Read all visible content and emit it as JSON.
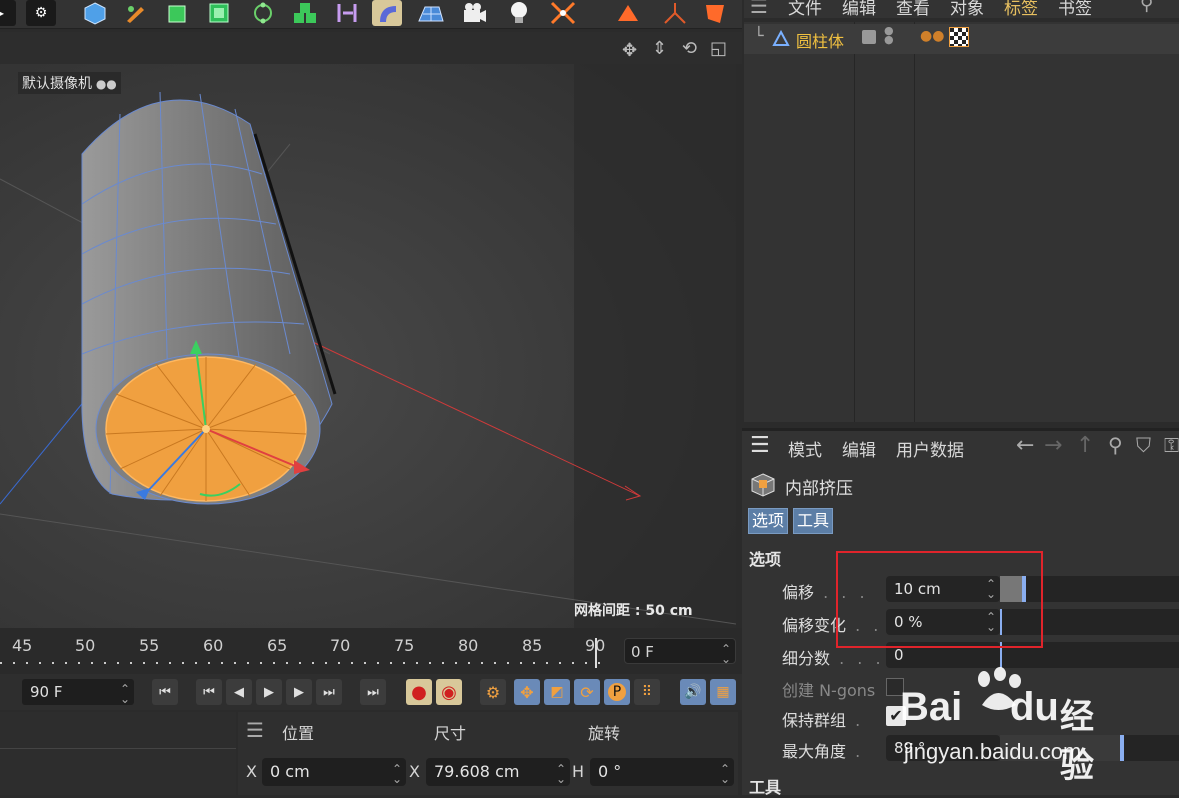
{
  "viewport": {
    "camera_label": "默认摄像机",
    "grid_spacing": "网格间距 : 50 cm"
  },
  "timeline": {
    "ticks": [
      "45",
      "50",
      "55",
      "60",
      "65",
      "70",
      "75",
      "80",
      "85",
      "90"
    ],
    "current_frame": "0 F",
    "end_frame": "90 F"
  },
  "coords": {
    "headers": {
      "position": "位置",
      "size": "尺寸",
      "rotation": "旋转"
    },
    "row_x": {
      "pos_axis": "X",
      "pos_value": "0 cm",
      "size_axis": "X",
      "size_value": "79.608 cm",
      "rot_axis": "H",
      "rot_value": "0 °"
    }
  },
  "object_manager": {
    "menu": [
      "文件",
      "编辑",
      "查看",
      "对象",
      "标签",
      "书签"
    ],
    "object_name": "圆柱体"
  },
  "attributes": {
    "menu": [
      "模式",
      "编辑",
      "用户数据"
    ],
    "tool_name": "内部挤压",
    "tabs": [
      "选项",
      "工具"
    ],
    "section_options": "选项",
    "section_tool": "工具",
    "offset_label": "偏移",
    "offset_value": "10 cm",
    "offset_variation_label": "偏移变化",
    "offset_variation_value": "0 %",
    "subdivision_label": "细分数",
    "subdivision_value": "0",
    "create_ngons_label": "创建 N-gons",
    "preserve_groups_label": "保持群组",
    "max_angle_label": "最大角度",
    "max_angle_value": "89 °"
  },
  "watermark": {
    "brand": "Bai",
    "brand2": "du",
    "brand_cn": "经验",
    "url": "jingyan.baidu.com"
  },
  "colors": {
    "accent_blue": "#5c7ea6",
    "highlight_red": "#e0242b",
    "selected_orange": "#f0a040",
    "label_yellow": "#f0c040"
  }
}
